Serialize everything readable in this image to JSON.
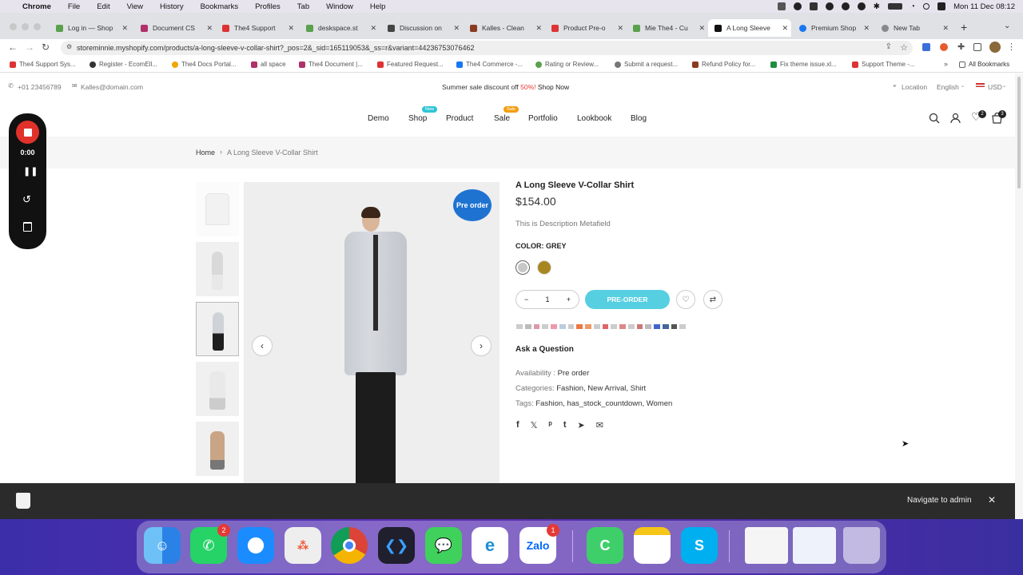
{
  "menubar": {
    "app": "Chrome",
    "items": [
      "File",
      "Edit",
      "View",
      "History",
      "Bookmarks",
      "Profiles",
      "Tab",
      "Window",
      "Help"
    ],
    "clock": "Mon 11 Dec  08:12"
  },
  "tabs": [
    {
      "label": "Log in — Shop",
      "color": "#5aa14b"
    },
    {
      "label": "Document CS",
      "color": "#b0306a"
    },
    {
      "label": "The4 Support",
      "color": "#d33"
    },
    {
      "label": "deskspace.st",
      "color": "#5aa14b"
    },
    {
      "label": "Discussion on",
      "color": "#444"
    },
    {
      "label": "Kalles - Clean",
      "color": "#8a3a1e"
    },
    {
      "label": "Product Pre-o",
      "color": "#d33"
    },
    {
      "label": "Mie The4 - Cu",
      "color": "#5aa14b"
    },
    {
      "label": "A Long Sleeve",
      "color": "#111",
      "active": true
    },
    {
      "label": "Premium Shop",
      "color": "#1877f2"
    },
    {
      "label": "New Tab",
      "color": "#888"
    }
  ],
  "address": {
    "url": "storeminnie.myshopify.com/products/a-long-sleeve-v-collar-shirt?_pos=2&_sid=165119053&_ss=r&variant=44236753076462"
  },
  "bookmarks": [
    {
      "label": "The4 Support Sys...",
      "color": "#d33"
    },
    {
      "label": "Register - EcomEll...",
      "color": "#333"
    },
    {
      "label": "The4 Docs Portal...",
      "color": "#f0a500"
    },
    {
      "label": "all space",
      "color": "#b0306a"
    },
    {
      "label": "The4 Document |...",
      "color": "#b0306a"
    },
    {
      "label": "Featured Request...",
      "color": "#d33"
    },
    {
      "label": "The4 Commerce -...",
      "color": "#1877f2"
    },
    {
      "label": "Rating or Review...",
      "color": "#5aa14b"
    },
    {
      "label": "Submit a request...",
      "color": "#777"
    },
    {
      "label": "Refund Policy for...",
      "color": "#8a3a1e"
    },
    {
      "label": "Fix theme issue.xl...",
      "color": "#1e8e3e"
    },
    {
      "label": "Support Theme -...",
      "color": "#d33"
    }
  ],
  "all_bookmarks": "All Bookmarks",
  "topbar": {
    "phone": "+01 23456789",
    "email": "Kalles@domain.com",
    "promo_text": "Summer sale discount off",
    "promo_pct": "50%!",
    "promo_link": "Shop Now",
    "location": "Location",
    "language": "English",
    "currency": "USD"
  },
  "nav": {
    "items": [
      "Demo",
      "Shop",
      "Product",
      "Sale",
      "Portfolio",
      "Lookbook",
      "Blog"
    ],
    "badge_new": "New",
    "badge_sale": "Sale",
    "wishlist_count": "2",
    "cart_count": "3"
  },
  "breadcrumb": {
    "home": "Home",
    "current": "A Long Sleeve V-Collar Shirt"
  },
  "product": {
    "title": "A Long Sleeve V-Collar Shirt",
    "price": "$154.00",
    "description": "This is Description Metafield",
    "color_label": "COLOR:",
    "color_value": "GREY",
    "qty": "1",
    "preorder_button": "PRE-ORDER",
    "badge": "Pre order",
    "ask": "Ask a Question",
    "availability_label": "Availability :",
    "availability_value": "Pre order",
    "categories_label": "Categories:",
    "categories_value": "Fashion, New Arrival, Shirt",
    "tags_label": "Tags:",
    "tags_value": "Fashion, has_stock_countdown, Women"
  },
  "recorder": {
    "time": "0:00"
  },
  "admin": {
    "navigate": "Navigate to admin"
  },
  "dock": {
    "whatsapp_badge": "2",
    "zalo_badge": "1",
    "zalo_label": "Zalo"
  }
}
